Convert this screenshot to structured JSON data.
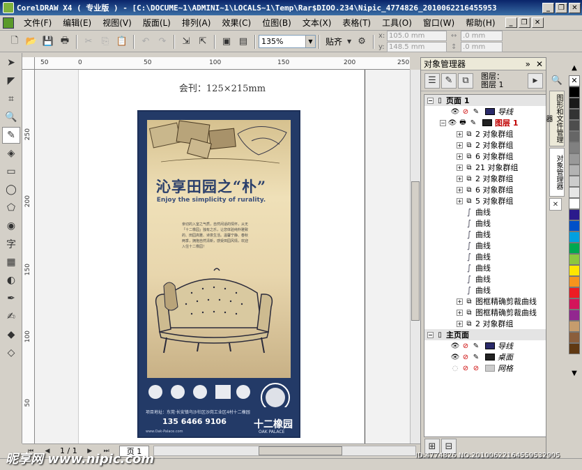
{
  "window": {
    "title": "CorelDRAW X4 ( 专业版 ) - [C:\\DOCUME~1\\ADMINI~1\\LOCALS~1\\Temp\\Rar$DIOO.234\\Nipic_4774826_2010062216455953"
  },
  "menu": [
    "文件(F)",
    "编辑(E)",
    "视图(V)",
    "版面(L)",
    "排列(A)",
    "效果(C)",
    "位图(B)",
    "文本(X)",
    "表格(T)",
    "工具(O)",
    "窗口(W)",
    "帮助(H)"
  ],
  "toolbar": {
    "zoom": "135%",
    "snap": "贴齐",
    "x_value": "105.0 mm",
    "y_value": "148.5 mm",
    "w_value": ".0 mm",
    "h_value": ".0 mm",
    "x_label": "x:",
    "y_label": "y:"
  },
  "rulers": {
    "h_ticks": [
      "50",
      "0",
      "50",
      "100",
      "150",
      "200",
      "250"
    ],
    "v_ticks": [
      "250",
      "200",
      "150",
      "100",
      "50"
    ]
  },
  "canvas": {
    "caption": "会刊：125×215mm"
  },
  "poster": {
    "headline": "沁享田园之“朴”",
    "subline": "Enjoy the simplicity of rurality.",
    "body": "亲切的入室之气质，自然闲适的情怀，从无「十二橡园」独有之乐，让您体验纯朴雅致的、田园高雅、诗意生活。温馨宁静、春秋两季，拥抱自然清新，感受田园风情，欢迎入住十二橡园！",
    "phone": "135 6466 9106",
    "address": "项目地址：东莞·长安镇乌沙社区沙岗工业区4村十二橡园",
    "brand": "十二橡园",
    "brand_en": "OAK PALACE",
    "web": "www.Oak-Palace.com"
  },
  "page_nav": {
    "counter": "1 / 1",
    "tab": "页 1"
  },
  "docker": {
    "title": "对象管理器",
    "layer_label": "图层：",
    "layer_name": "图层 1",
    "tree": [
      {
        "kind": "page",
        "label": "页面 1"
      },
      {
        "kind": "layer",
        "label": "导线",
        "italic": true,
        "color": "#2a2a6a"
      },
      {
        "kind": "layer-active",
        "label": "图层 1",
        "color": "#222222"
      },
      {
        "kind": "group",
        "label": "2 对象群组"
      },
      {
        "kind": "group",
        "label": "2 对象群组"
      },
      {
        "kind": "group",
        "label": "6 对象群组"
      },
      {
        "kind": "group",
        "label": "21 对象群组"
      },
      {
        "kind": "group",
        "label": "2 对象群组"
      },
      {
        "kind": "group",
        "label": "6 对象群组"
      },
      {
        "kind": "group",
        "label": "5 对象群组"
      },
      {
        "kind": "curve",
        "label": "曲线"
      },
      {
        "kind": "curve",
        "label": "曲线"
      },
      {
        "kind": "curve",
        "label": "曲线"
      },
      {
        "kind": "curve",
        "label": "曲线"
      },
      {
        "kind": "curve",
        "label": "曲线"
      },
      {
        "kind": "curve",
        "label": "曲线"
      },
      {
        "kind": "curve",
        "label": "曲线"
      },
      {
        "kind": "curve",
        "label": "曲线"
      },
      {
        "kind": "group",
        "label": "图框精确剪裁曲线"
      },
      {
        "kind": "group",
        "label": "图框精确剪裁曲线"
      },
      {
        "kind": "group",
        "label": "2 对象群组"
      },
      {
        "kind": "page",
        "label": "主页面"
      },
      {
        "kind": "layer",
        "label": "导线",
        "italic": true,
        "color": "#2a2a6a"
      },
      {
        "kind": "layer",
        "label": "桌面",
        "italic": true,
        "color": "#222222"
      },
      {
        "kind": "layer",
        "label": "网格",
        "italic": true,
        "color": "#cccccc"
      }
    ]
  },
  "docker_tabs": [
    "图形和文件管理器",
    "对象管理器"
  ],
  "palette": [
    "#ffffff",
    "#000000",
    "#1a1a1a",
    "#333333",
    "#4d4d4d",
    "#666666",
    "#808080",
    "#999999",
    "#b3b3b3",
    "#cccccc",
    "#e6e6e6",
    "#ffffff",
    "#2b1b8c",
    "#0050c8",
    "#00a0e0",
    "#00a850",
    "#8cc63f",
    "#ffe600",
    "#f7941d",
    "#ed1c24",
    "#d4145a",
    "#92278f",
    "#c69c6d",
    "#8b5e3c",
    "#603913"
  ],
  "watermark": {
    "site": "昵享网 www.nipic.com",
    "id": "ID:4774826 NO:20100622164559532905"
  }
}
